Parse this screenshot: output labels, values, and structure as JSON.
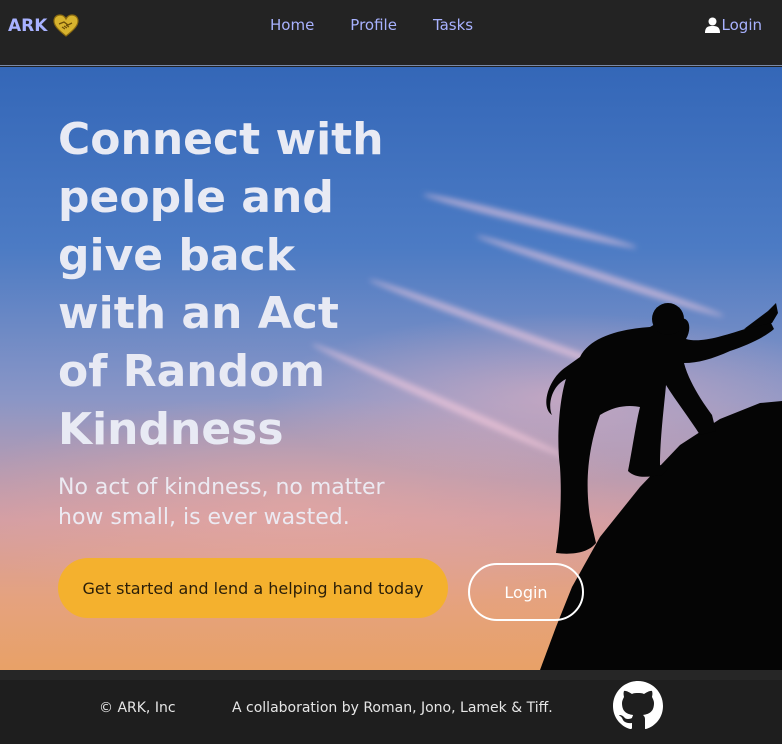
{
  "brand": {
    "name": "ARK",
    "logo_icon": "heart-handshake-icon",
    "logo_color": "#d7b32e"
  },
  "nav": {
    "links": [
      "Home",
      "Profile",
      "Tasks"
    ],
    "login_label": "Login",
    "login_icon": "user-icon"
  },
  "hero": {
    "title": "Connect with people and give back with an Act of Random Kindness",
    "subtitle": "No act of kindness, no matter how small, is ever wasted.",
    "cta_label": "Get started and lend a helping hand today",
    "login_label": "Login",
    "background": "sunset-sky-with-climber-silhouette"
  },
  "footer": {
    "copyright": "© ARK, Inc",
    "credits": "A collaboration by Roman, Jono, Lamek & Tiff.",
    "github_icon": "github-icon"
  },
  "colors": {
    "link": "#a8b2ff",
    "cta": "#f4b12e",
    "navbar": "#232323",
    "footer": "#1e1e1e"
  }
}
